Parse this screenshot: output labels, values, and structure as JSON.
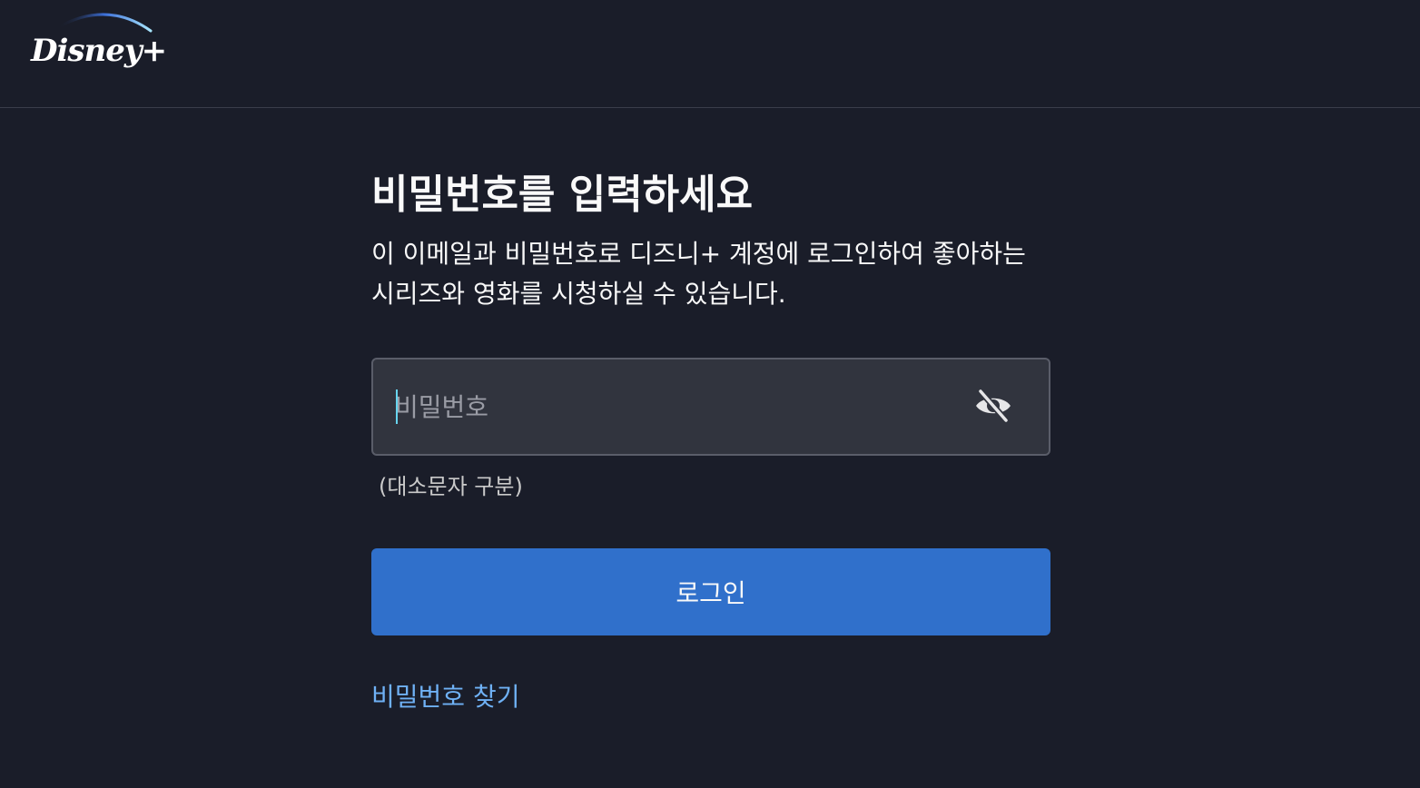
{
  "header": {
    "logo_text": "Disney+"
  },
  "main": {
    "title": "비밀번호를 입력하세요",
    "description": "이 이메일과 비밀번호로 디즈니+ 계정에 로그인하여 좋아하는 시리즈와 영화를 시청하실 수 있습니다.",
    "password_field": {
      "placeholder": "비밀번호",
      "value": "",
      "toggle_icon": "eye-slash-icon"
    },
    "hint": "(대소문자 구분)",
    "login_button": "로그인",
    "forgot_link": "비밀번호 찾기"
  },
  "colors": {
    "background": "#1a1d29",
    "field_background": "#31343e",
    "primary_button": "#3070cb",
    "link": "#6fb1f5"
  }
}
